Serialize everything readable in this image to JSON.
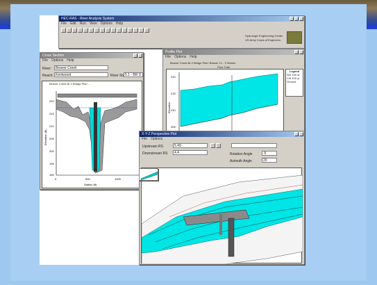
{
  "colors": {
    "banner_top": "#6a5a3c",
    "banner_blue": "#1f3fd6",
    "slide_bg": "#a8cff3",
    "window_face": "#d4d0c8",
    "title_active": "#0a246a",
    "water": "#00e5e5",
    "ground": "#9a9a9a"
  },
  "main_window": {
    "title": "HEC-RAS - River Analysis System",
    "menu": [
      "File",
      "Edit",
      "Run",
      "View",
      "Options",
      "Help"
    ],
    "info_line1": "Hydrologic Engineering Center",
    "info_line2": "US Army Corps of Engineers"
  },
  "cross_section_window": {
    "title": "Cross Section",
    "menu": [
      "File",
      "Options",
      "Help"
    ],
    "river_label": "River:",
    "river_value": "Beaver Creek",
    "reach_label": "Reach:",
    "reach_value": "Kentwood",
    "river_sta_label": "River Sta.",
    "river_sta_value": "5.1 - BR D",
    "plot_title": "Beaver Creek  Br 2 Bridge  Plan  ...",
    "ylabel": "Elevation (ft)",
    "xlabel": "Station (ft)",
    "y_ticks": [
      "220",
      "215",
      "210",
      "205",
      "200",
      "195",
      "190"
    ],
    "x_ticks": [
      "0",
      "500",
      "1000"
    ]
  },
  "profile_window": {
    "title": "Profile Plot",
    "menu": [
      "File",
      "Options",
      "Help"
    ],
    "plot_title": "Beaver Creek Br 2 Bridge  Plan: Beaver Cr - 3 Stories",
    "plot_subtitle": "Flow Total",
    "ylabel": "Elevation",
    "y_ticks": [
      "220",
      "215",
      "210",
      "205"
    ],
    "legend_title": "Legend",
    "legend_items": [
      "WS  100 yr",
      "Crit  100 yr",
      "Ground"
    ]
  },
  "perspective_window": {
    "title": "X-Y-Z Perspective Plot",
    "menu": [
      "File",
      "Options"
    ],
    "upstream_label": "Upstream RS",
    "upstream_value": "5.49",
    "downstream_label": "Downstream RS",
    "downstream_value": "4.4",
    "rotation_label": "Rotation Angle",
    "rotation_value": "-5",
    "azimuth_label": "Azimuth Angle",
    "azimuth_value": "20"
  }
}
